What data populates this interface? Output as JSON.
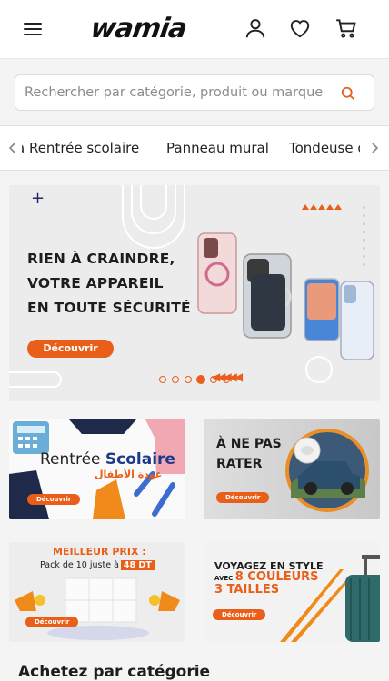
{
  "header": {
    "logo": "wamia",
    "menu_icon": "hamburger-menu-icon",
    "account_icon": "user-icon",
    "wishlist_icon": "heart-icon",
    "cart_icon": "cart-icon"
  },
  "search": {
    "placeholder": "Rechercher par catégorie, produit ou marque",
    "value": "",
    "icon": "search-icon"
  },
  "categories": {
    "items": [
      "a Rentrée scolaire",
      "Panneau mural",
      "Tondeuse c"
    ]
  },
  "hero": {
    "line1": "RIEN À CRAINDRE,",
    "line2": "VOTRE APPAREIL",
    "line3": "EN TOUTE SÉCURITÉ",
    "cta": "Découvrir",
    "slides_total": 6,
    "active_slide": 4
  },
  "promos": [
    {
      "title_a": "Rentrée ",
      "title_b": "Scolaire",
      "subtitle": "عودة الأطفال",
      "cta": "Découvrir"
    },
    {
      "title_line1": "À NE PAS",
      "title_line2": "RATER",
      "cta": "Découvrir"
    },
    {
      "title": "MEILLEUR PRIX :",
      "subtitle": "Pack de 10 juste à",
      "price": "48 DT",
      "cta": "Découvrir"
    },
    {
      "line1": "VOYAGEZ EN STYLE",
      "line2_prefix": "AVEC",
      "line2_strong": "8 COULEURS",
      "line3": "3 TAILLES",
      "cta": "Découvrir"
    }
  ],
  "sections": {
    "categories_title": "Achetez par catégorie"
  },
  "colors": {
    "accent": "#e95f1a",
    "navy": "#1d3a8a"
  }
}
